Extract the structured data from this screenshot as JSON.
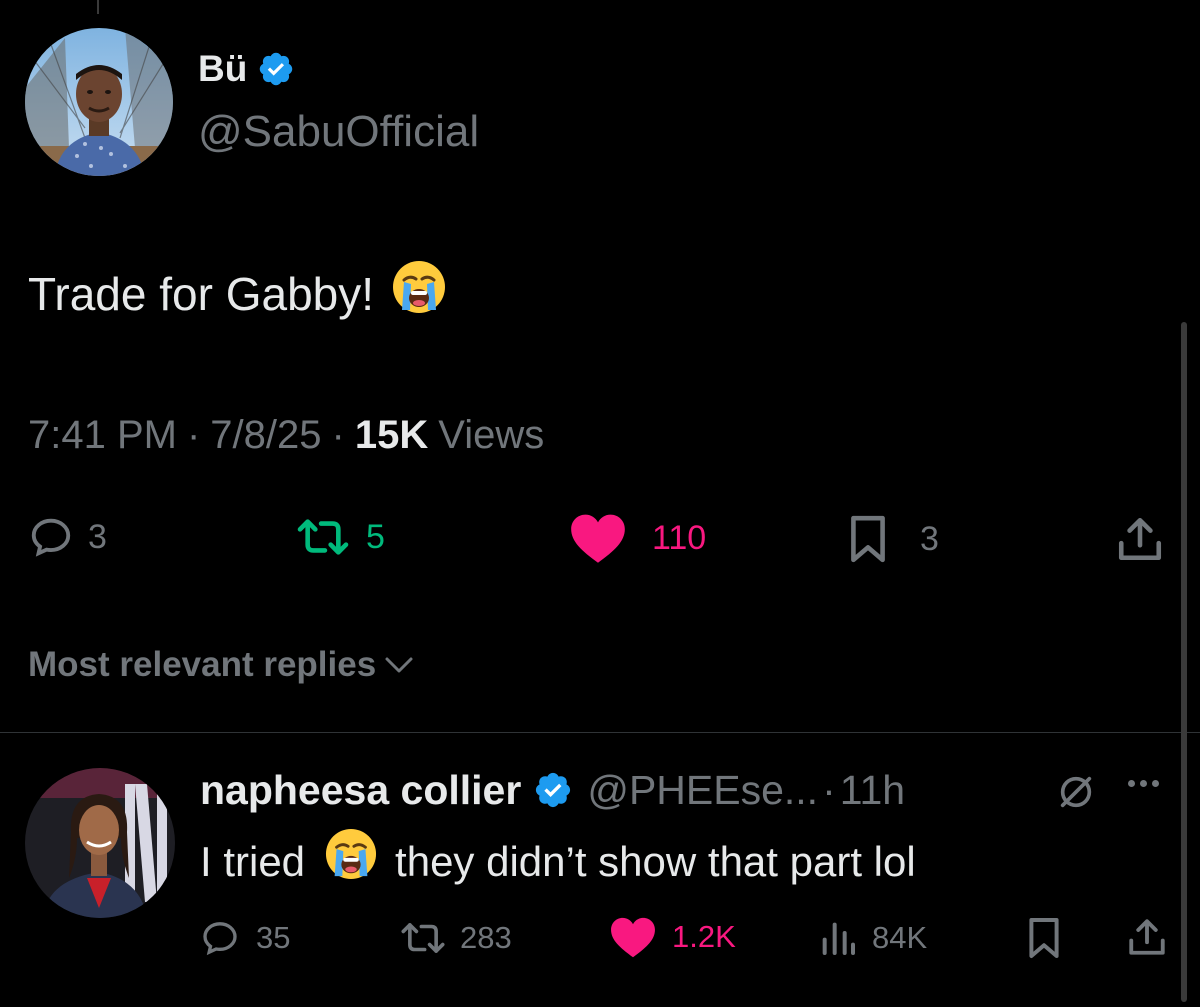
{
  "tweet": {
    "display_name": "Bü",
    "handle": "@SabuOfficial",
    "text": "Trade for Gabby!",
    "emoji": "loudly-crying-face",
    "time": "7:41 PM",
    "date": "7/8/25",
    "views_count": "15K",
    "views_label": "Views",
    "sep": "·",
    "actions": {
      "replies": "3",
      "reposts": "5",
      "likes": "110",
      "bookmarks": "3"
    }
  },
  "replies_filter": {
    "label": "Most relevant replies"
  },
  "reply": {
    "display_name": "napheesa collier",
    "handle": "@PHEEse...",
    "sep": "·",
    "age": "11h",
    "text_before": "I tried",
    "text_after": "they didn’t show that part lol",
    "emoji": "loudly-crying-face",
    "actions": {
      "replies": "35",
      "reposts": "283",
      "likes": "1.2K",
      "views": "84K"
    }
  },
  "colors": {
    "background": "#000000",
    "text": "#e7e9ea",
    "muted": "#71767b",
    "verified": "#1d9bf0",
    "repost_active": "#00ba7c",
    "like_active": "#f91880"
  }
}
